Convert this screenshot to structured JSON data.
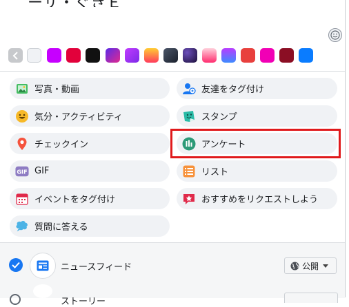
{
  "composer": {
    "top_text": "ーサ・ぐきＥ",
    "emoji_button": "smiley-icon"
  },
  "backgrounds": {
    "swatches": [
      {
        "name": "collapse",
        "color": "#c7c9cc"
      },
      {
        "name": "plain",
        "color": "#f0f2f5"
      },
      {
        "name": "magenta",
        "color": "#c600ff"
      },
      {
        "name": "red",
        "color": "#e2013b"
      },
      {
        "name": "black",
        "color": "#111111"
      },
      {
        "name": "purple-gradient",
        "color": "#7d2ae8"
      },
      {
        "name": "violet-gradient",
        "color": "#a033ff"
      },
      {
        "name": "orange-gradient",
        "color": "#f5a623"
      },
      {
        "name": "dark-gradient",
        "color": "#34495e"
      },
      {
        "name": "galaxy",
        "color": "#2c1b55"
      },
      {
        "name": "pink-gradient",
        "color": "#ff5e98"
      },
      {
        "name": "blue-gradient",
        "color": "#5b6cff"
      },
      {
        "name": "coral",
        "color": "#ea3e3e"
      },
      {
        "name": "hot-pink",
        "color": "#ff00b3"
      },
      {
        "name": "maroon",
        "color": "#8b0e24"
      },
      {
        "name": "blue",
        "color": "#0a7cff"
      }
    ]
  },
  "actions": [
    {
      "label": "写真・動画",
      "icon": "photo-icon"
    },
    {
      "label": "友達をタグ付け",
      "icon": "tag-friends-icon"
    },
    {
      "label": "気分・アクティビティ",
      "icon": "feeling-icon"
    },
    {
      "label": "スタンプ",
      "icon": "sticker-icon"
    },
    {
      "label": "チェックイン",
      "icon": "location-pin-icon"
    },
    {
      "label": "アンケート",
      "icon": "poll-icon"
    },
    {
      "label": "GIF",
      "icon": "gif-icon"
    },
    {
      "label": "リスト",
      "icon": "list-icon"
    },
    {
      "label": "イベントをタグ付け",
      "icon": "calendar-icon"
    },
    {
      "label": "おすすめをリクエストしよう",
      "icon": "recommendation-icon"
    },
    {
      "label": "質問に答える",
      "icon": "question-bubble-icon"
    }
  ],
  "footer": {
    "news_feed_label": "ニュースフィード",
    "privacy_label": "公開",
    "story_label": "ストーリー"
  },
  "colors": {
    "accent": "#1877f2",
    "highlight": "#e0191b",
    "pill_bg": "#f0f2f5"
  }
}
